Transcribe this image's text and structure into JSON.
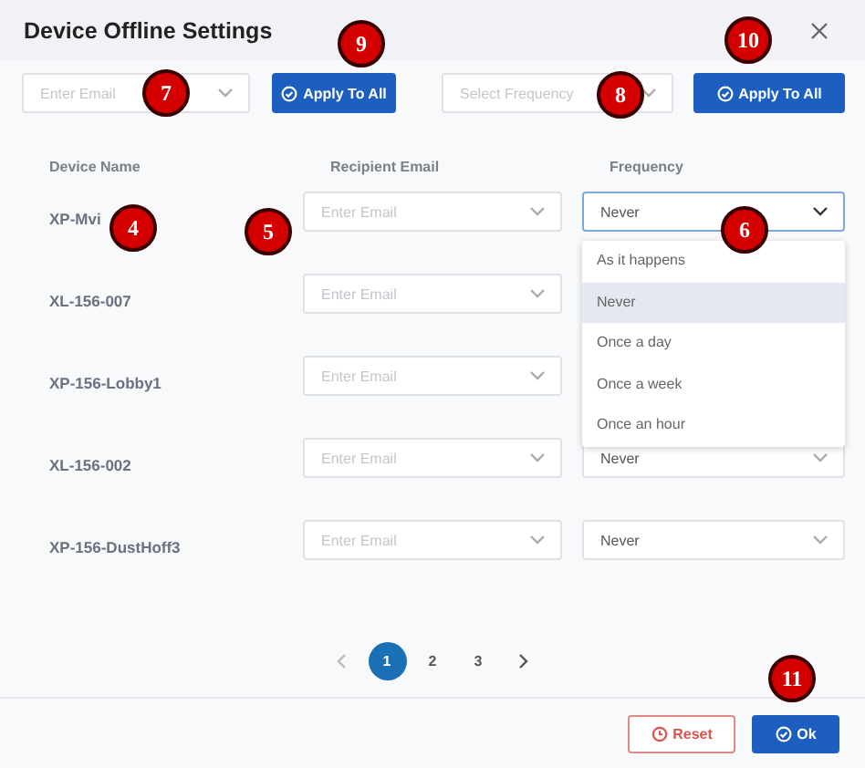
{
  "dialog": {
    "title": "Device Offline Settings"
  },
  "bulk": {
    "email": {
      "placeholder": "Enter Email"
    },
    "email_button": "Apply To All",
    "frequency": {
      "placeholder": "Select Frequency"
    },
    "frequency_button": "Apply To All"
  },
  "columns": [
    "Device Name",
    "Recipient Email",
    "Frequency"
  ],
  "rows": [
    {
      "device": "XP-Mvi",
      "email_placeholder": "Enter Email",
      "frequency": "Never",
      "open": true
    },
    {
      "device": "XL-156-007",
      "email_placeholder": "Enter Email"
    },
    {
      "device": "XP-156-Lobby1",
      "email_placeholder": "Enter Email"
    },
    {
      "device": "XL-156-002",
      "email_placeholder": "Enter Email",
      "frequency": "Never",
      "open": false
    },
    {
      "device": "XP-156-DustHoff3",
      "email_placeholder": "Enter Email",
      "frequency": "Never",
      "open": false
    }
  ],
  "dropdown": [
    {
      "label": "As it happens",
      "selected": false
    },
    {
      "label": "Never",
      "selected": true
    },
    {
      "label": "Once a day",
      "selected": false
    },
    {
      "label": "Once a week",
      "selected": false
    },
    {
      "label": "Once an hour",
      "selected": false
    }
  ],
  "pagination": [
    {
      "label": "1",
      "selected": true
    },
    {
      "label": "2",
      "selected": false
    },
    {
      "label": "3",
      "selected": false
    }
  ],
  "footer": {
    "reset": "Reset",
    "ok": "Ok"
  },
  "callouts": [
    "9",
    "10",
    "7",
    "8",
    "4",
    "5",
    "6",
    "11"
  ]
}
